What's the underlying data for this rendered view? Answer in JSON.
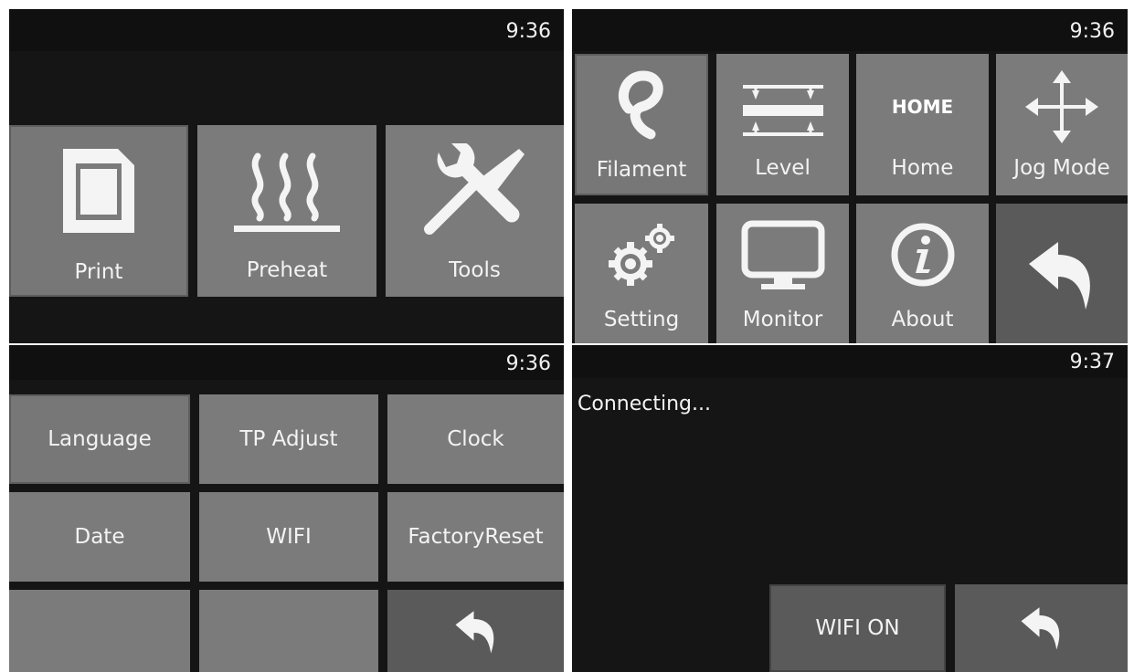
{
  "screens": {
    "main_menu": {
      "time": "9:36",
      "items": [
        {
          "label": "Print",
          "icon": "sd-card-icon"
        },
        {
          "label": "Preheat",
          "icon": "heat-waves-icon"
        },
        {
          "label": "Tools",
          "icon": "wrench-screwdriver-icon"
        }
      ]
    },
    "tools_menu": {
      "time": "9:36",
      "items": [
        {
          "label": "Filament",
          "icon": "filament-icon"
        },
        {
          "label": "Level",
          "icon": "level-arrows-icon"
        },
        {
          "label": "Home",
          "icon": "home-text-icon",
          "icon_text": "HOME"
        },
        {
          "label": "Jog Mode",
          "icon": "move-arrows-icon"
        },
        {
          "label": "Setting",
          "icon": "gears-icon"
        },
        {
          "label": "Monitor",
          "icon": "monitor-icon"
        },
        {
          "label": "About",
          "icon": "info-icon"
        },
        {
          "label": "",
          "icon": "back-arrow-icon"
        }
      ]
    },
    "setting_menu": {
      "time": "9:36",
      "items": [
        {
          "label": "Language"
        },
        {
          "label": "TP Adjust"
        },
        {
          "label": "Clock"
        },
        {
          "label": "Date"
        },
        {
          "label": "WIFI"
        },
        {
          "label": "FactoryReset"
        }
      ]
    },
    "wifi_screen": {
      "time": "9:37",
      "status": "Connecting...",
      "wifi_button": "WIFI ON"
    }
  }
}
